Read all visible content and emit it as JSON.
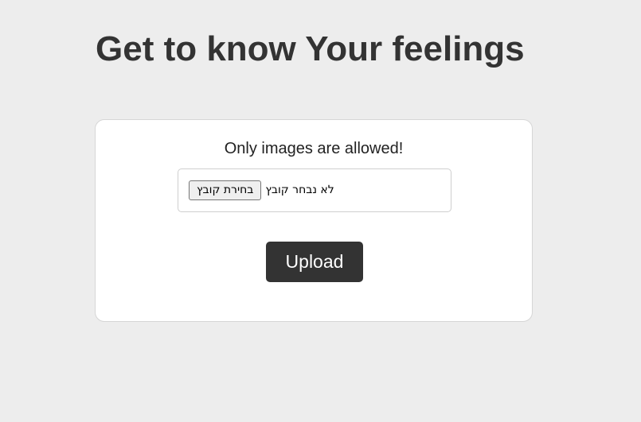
{
  "page": {
    "title": "Get to know Your feelings",
    "background_color": "#ededed"
  },
  "upload_card": {
    "notice": "Only images are allowed!",
    "file_input": {
      "button_label": "בחירת קובץ",
      "status_text": "לא נבחר קובץ"
    },
    "upload_button_label": "Upload",
    "colors": {
      "card_background": "#ffffff",
      "button_background": "#333333",
      "button_text": "#ffffff",
      "title_text": "#333333"
    }
  }
}
